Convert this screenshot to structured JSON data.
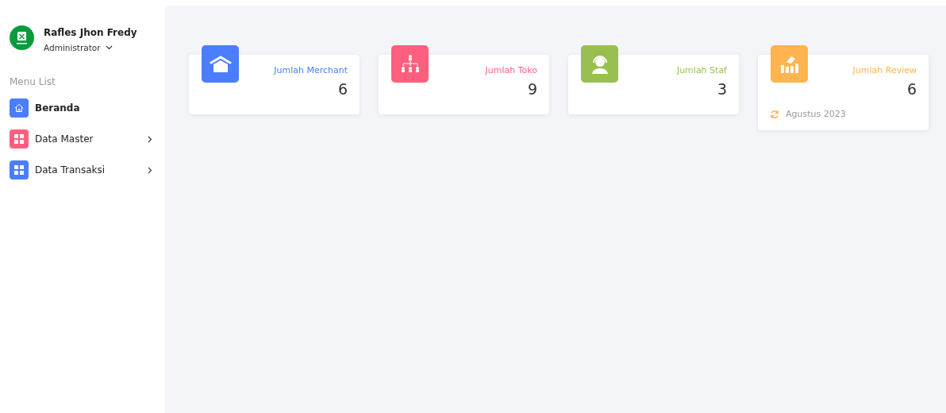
{
  "user": {
    "name": "Rafles Jhon Fredy",
    "role": "Administrator"
  },
  "sidebar": {
    "heading": "Menu List",
    "items": [
      {
        "label": "Beranda",
        "kind": "home",
        "color": "#4a7dff",
        "selected": true,
        "expandable": false
      },
      {
        "label": "Data Master",
        "kind": "grid",
        "color": "#ff5f7e",
        "selected": false,
        "expandable": true
      },
      {
        "label": "Data Transaksi",
        "kind": "grid",
        "color": "#4a7dff",
        "selected": false,
        "expandable": true
      }
    ]
  },
  "cards": [
    {
      "kind": "store",
      "color": "#4a7dff",
      "label": "Jumlah Merchant",
      "value": "6"
    },
    {
      "kind": "hierarchy",
      "color": "#ff5f7e",
      "label": "Jumlah Toko",
      "value": "9"
    },
    {
      "kind": "staff",
      "color": "#98c050",
      "label": "Jumlah Staf",
      "value": "3"
    },
    {
      "kind": "review",
      "color": "#ffb44f",
      "label": "Jumlah Review",
      "value": "6",
      "period": "Agustus 2023"
    }
  ]
}
